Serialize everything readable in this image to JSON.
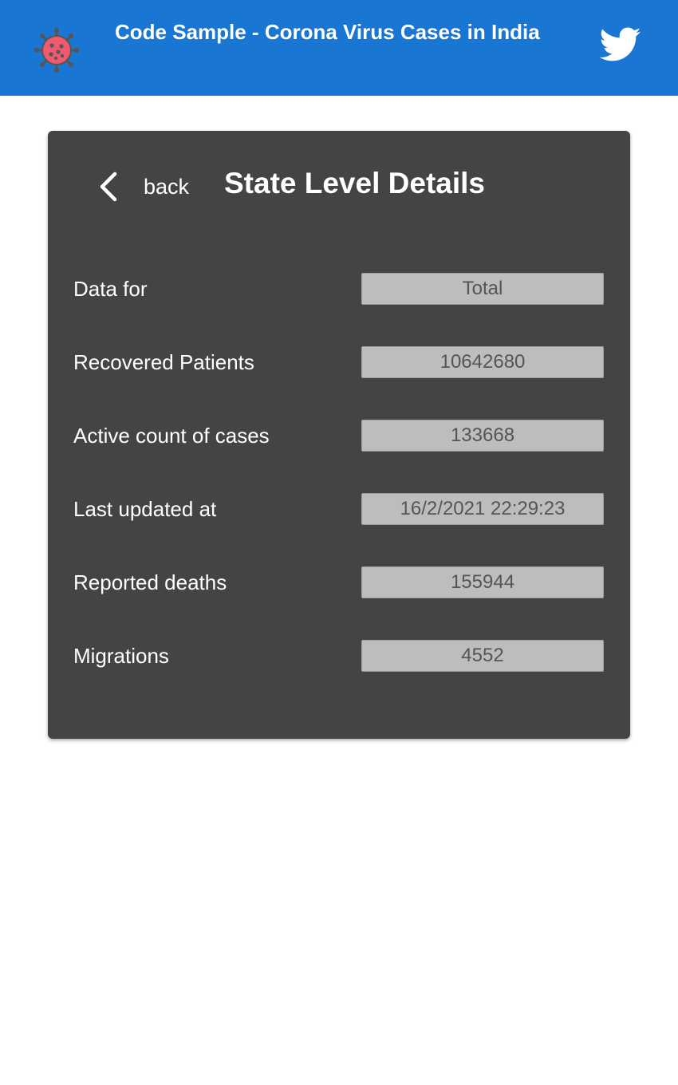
{
  "header": {
    "title": "Code Sample - Corona Virus Cases in India",
    "logo_icon": "virus-icon",
    "social_icon": "twitter-icon",
    "bg_color": "#1976d2"
  },
  "card": {
    "back_label": "back",
    "back_icon": "chevron-left-icon",
    "title": "State Level Details",
    "bg_color": "#444444",
    "rows": [
      {
        "label": "Data for",
        "value": "Total"
      },
      {
        "label": "Recovered Patients",
        "value": "10642680"
      },
      {
        "label": "Active count of cases",
        "value": "133668"
      },
      {
        "label": "Last updated at",
        "value": "16/2/2021 22:29:23"
      },
      {
        "label": "Reported deaths",
        "value": "155944"
      },
      {
        "label": "Migrations",
        "value": "4552"
      }
    ]
  }
}
